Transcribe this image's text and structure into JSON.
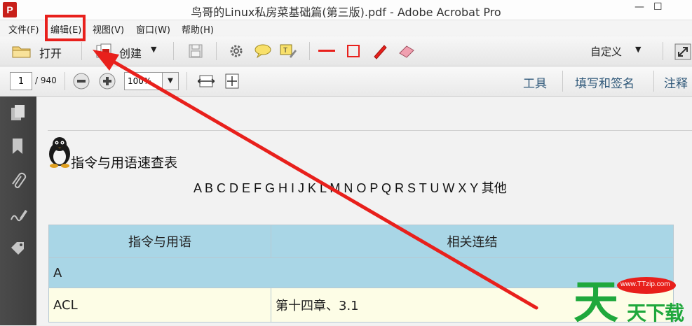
{
  "window": {
    "app_icon_letter": "P",
    "title": "鸟哥的Linux私房菜基础篇(第三版).pdf - Adobe Acrobat Pro"
  },
  "menu": {
    "items": [
      "文件(F)",
      "编辑(E)",
      "视图(V)",
      "窗口(W)",
      "帮助(H)"
    ],
    "highlighted": "编辑(E)"
  },
  "toolbar": {
    "open_label": "打开",
    "create_label": "创建",
    "customize_label": "自定义"
  },
  "nav": {
    "page_current": "1",
    "page_total": "/ 940",
    "zoom": "100%",
    "tools_label": "工具",
    "fill_sign_label": "填写和签名",
    "comment_label": "注释"
  },
  "document": {
    "title": "指令与用语速查表",
    "alphabet": "A B C D E F G H I J K L M N O P Q R S T U W X Y 其他",
    "table": {
      "headers": [
        "指令与用语",
        "相关连结"
      ],
      "section": "A",
      "rows": [
        [
          "ACL",
          "第十四章、3.1"
        ]
      ]
    }
  },
  "watermark": {
    "site": "www.TTzip.com",
    "text": "天下载"
  },
  "colors": {
    "annotation_red": "#e8201c",
    "table_header": "#a9d6e6",
    "table_row": "#fdfde6",
    "sidebar": "#444444"
  }
}
